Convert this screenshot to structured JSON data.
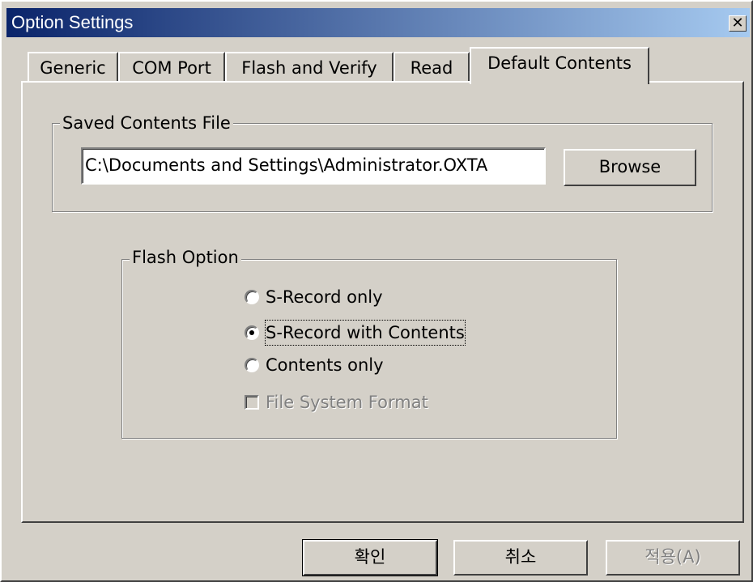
{
  "window": {
    "title": "Option Settings",
    "close_glyph": "✕"
  },
  "tabs": [
    {
      "label": "Generic"
    },
    {
      "label": "COM Port"
    },
    {
      "label": "Flash and Verify"
    },
    {
      "label": "Read"
    },
    {
      "label": "Default Contents"
    }
  ],
  "active_tab": "Default Contents",
  "saved_contents": {
    "group_label": "Saved Contents File",
    "path_value": "C:\\Documents and Settings\\Administrator.OXTA",
    "browse_label": "Browse"
  },
  "flash_option": {
    "group_label": "Flash Option",
    "options": [
      {
        "label": "S-Record only",
        "selected": false
      },
      {
        "label": "S-Record with Contents",
        "selected": true
      },
      {
        "label": "Contents only",
        "selected": false
      }
    ],
    "file_system_format": {
      "label": "File System Format",
      "checked": false,
      "enabled": false
    }
  },
  "footer": {
    "ok_label": "확인",
    "cancel_label": "취소",
    "apply_label": "적용(A)"
  }
}
